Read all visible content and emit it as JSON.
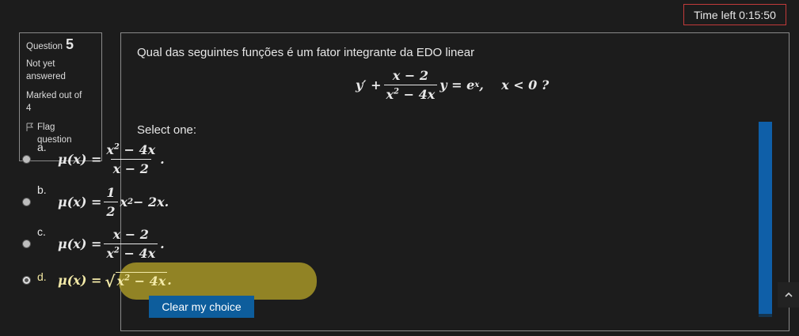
{
  "timer": {
    "label": "Time left 0:15:50"
  },
  "info": {
    "question_label": "Question",
    "question_number": "5",
    "state_line1": "Not yet",
    "state_line2": "answered",
    "marked_line1": "Marked out of",
    "marked_line2": "4",
    "flag_line1": "Flag",
    "flag_line2": "question"
  },
  "question": {
    "text": "Qual das seguintes funções é um fator integrante da EDO linear",
    "equation": {
      "lhs_prefix": "y′ +",
      "frac_num": "x − 2",
      "frac_den": "x",
      "frac_den_exp": "2",
      "frac_den_rest": " − 4x",
      "after_frac": "y = e",
      "exp": "x",
      "condition": ",    x < 0 ?"
    }
  },
  "select_one": "Select one:",
  "options": [
    {
      "letter": "a.",
      "prefix": "μ(x) =",
      "num_base": "x",
      "num_exp": "2",
      "num_rest": " − 4x",
      "den": "x − 2",
      "suffix": "."
    },
    {
      "letter": "b.",
      "prefix": "μ(x) =",
      "frac_num": "1",
      "frac_den": "2",
      "base": "x",
      "exp": "2",
      "rest": " − 2x."
    },
    {
      "letter": "c.",
      "prefix": "μ(x) =",
      "num": "x − 2",
      "den_base": "x",
      "den_exp": "2",
      "den_rest": " − 4x",
      "suffix": "."
    },
    {
      "letter": "d.",
      "prefix": "μ(x) =",
      "rad_base": "x",
      "rad_exp": "2",
      "rad_rest": " − 4x",
      "suffix": "."
    }
  ],
  "selected_option": "d",
  "clear_button": "Clear my choice",
  "colors": {
    "highlight": "#b2a028",
    "timer_border": "#c23a3a",
    "button": "#0d5d9c",
    "scrollbar": "#0f5fa8"
  }
}
